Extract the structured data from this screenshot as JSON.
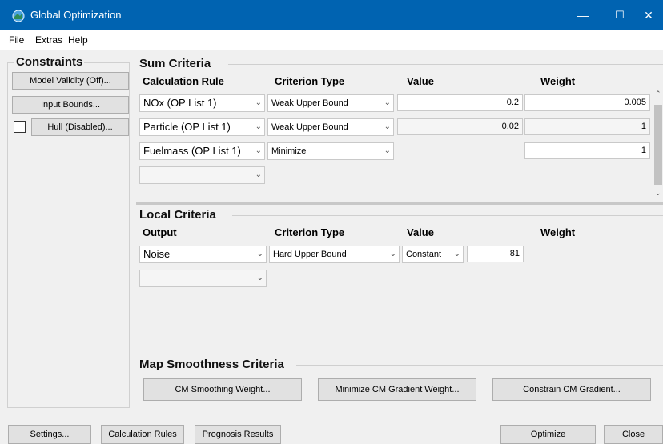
{
  "window": {
    "title": "Global Optimization",
    "minimize": "—",
    "maximize": "☐",
    "close": "✕"
  },
  "menu": [
    "File",
    "Extras",
    "Help"
  ],
  "constraints": {
    "title": "Constraints",
    "model_validity": "Model Validity (Off)...",
    "input_bounds": "Input Bounds...",
    "hull": "Hull (Disabled)...",
    "hull_checked": false
  },
  "sum_criteria": {
    "title": "Sum Criteria",
    "headers": [
      "Calculation Rule",
      "Criterion Type",
      "Value",
      "Weight"
    ],
    "rows": [
      {
        "rule": "NOx (OP List 1)",
        "type": "Weak Upper Bound",
        "value": "0.2",
        "weight": "0.005"
      },
      {
        "rule": "Particle (OP List 1)",
        "type": "Weak Upper Bound",
        "value": "0.02",
        "weight": "1"
      },
      {
        "rule": "Fuelmass (OP List 1)",
        "type": "Minimize",
        "value": "",
        "weight": "1"
      },
      {
        "rule": "",
        "type": "",
        "value": "",
        "weight": ""
      }
    ]
  },
  "local_criteria": {
    "title": "Local Criteria",
    "headers": [
      "Output",
      "Criterion Type",
      "Value",
      "Weight"
    ],
    "rows": [
      {
        "output": "Noise",
        "type": "Hard Upper Bound",
        "value_mode": "Constant",
        "value": "81"
      },
      {
        "output": "",
        "type": "",
        "value_mode": "",
        "value": ""
      }
    ]
  },
  "map_smoothness": {
    "title": "Map Smoothness Criteria",
    "buttons": [
      "CM Smoothing Weight...",
      "Minimize CM Gradient Weight...",
      "Constrain CM Gradient..."
    ]
  },
  "bottom_buttons": {
    "settings": "Settings...",
    "calculation_rules": "Calculation Rules",
    "prognosis_results": "Prognosis Results",
    "optimize": "Optimize",
    "close": "Close"
  },
  "colors": {
    "titlebar": "#0063b1",
    "background": "#f0f0f0"
  }
}
